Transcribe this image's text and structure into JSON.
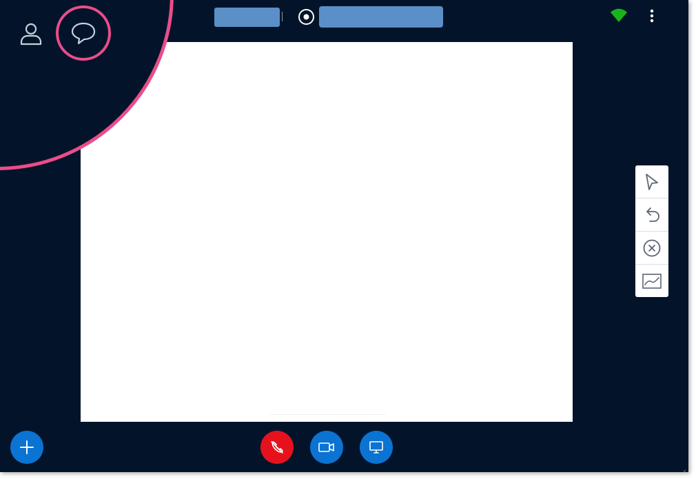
{
  "colors": {
    "background": "#03142a",
    "whiteboard": "#ffffff",
    "highlight": "#ea4d8a",
    "accent_blue": "#0b73d2",
    "redacted_blue": "#5b8fc8",
    "hangup_red": "#e5121d",
    "wifi_green": "#1bb31b"
  },
  "left_nav": {
    "participants_icon": "user-icon",
    "chat_icon": "chat-bubble-icon"
  },
  "header": {
    "recording_icon": "record-icon",
    "connection_icon": "wifi-signal-icon",
    "menu_icon": "more-vertical-icon"
  },
  "annotation_tools": [
    {
      "name": "pointer-tool",
      "icon": "cursor-arrow-icon"
    },
    {
      "name": "undo-tool",
      "icon": "undo-icon"
    },
    {
      "name": "clear-tool",
      "icon": "clear-x-circle-icon"
    },
    {
      "name": "pen-tool",
      "icon": "pen-drawing-icon"
    }
  ],
  "call_controls": {
    "add_icon": "plus-icon",
    "hangup_icon": "hangup-phone-icon",
    "video_icon": "video-camera-icon",
    "share_icon": "share-screen-icon"
  }
}
